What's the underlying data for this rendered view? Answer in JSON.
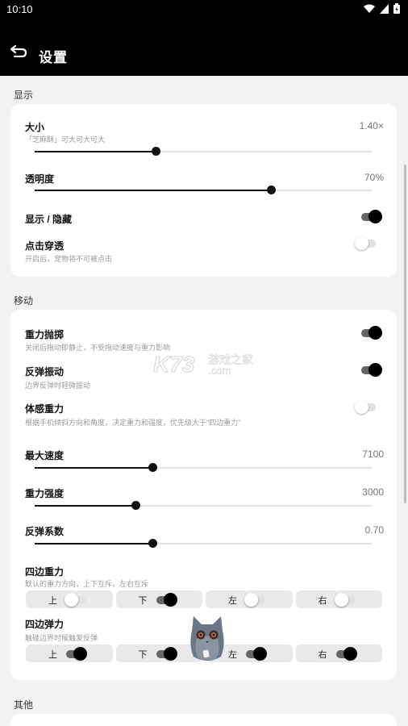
{
  "status_bar": {
    "time": "10:10"
  },
  "header": {
    "title": "设置"
  },
  "sections": {
    "display": {
      "title": "显示",
      "size": {
        "label": "大小",
        "desc": "「芝麻酥」可大可大可大",
        "value": "1.40×",
        "level": 0.36
      },
      "opacity": {
        "label": "透明度",
        "value": "70%",
        "level": 0.7
      },
      "visibility": {
        "label": "显示 / 隐藏",
        "on": true
      },
      "click_through": {
        "label": "点击穿透",
        "desc": "开启后，宠物将不可被点击",
        "on": false
      }
    },
    "movement": {
      "title": "移动",
      "gravity_throw": {
        "label": "重力抛掷",
        "desc": "关闭后拖动即静止，不受拖动速度与重力影响",
        "on": true
      },
      "bounce_vibrate": {
        "label": "反弹振动",
        "desc": "边界反弹时轻微振动",
        "on": true
      },
      "motion_gravity": {
        "label": "体感重力",
        "desc": "根据手机倾斜方向和角度，决定重力和强度。优先级大于\"四边重力\"",
        "on": false
      },
      "max_speed": {
        "label": "最大速度",
        "value": "7100",
        "level": 0.35
      },
      "gravity_strength": {
        "label": "重力强度",
        "value": "3000",
        "level": 0.3
      },
      "bounce_coef": {
        "label": "反弹系数",
        "value": "0.70",
        "level": 0.35
      },
      "edge_gravity": {
        "label": "四边重力",
        "desc": "默认的重力方向，上下互斥，左右互斥",
        "buttons": [
          {
            "label": "上",
            "on": false
          },
          {
            "label": "下",
            "on": true
          },
          {
            "label": "左",
            "on": false
          },
          {
            "label": "右",
            "on": false
          }
        ]
      },
      "edge_bounce": {
        "label": "四边弹力",
        "desc": "触碰边界时候触发反弹",
        "buttons": [
          {
            "label": "上",
            "on": true
          },
          {
            "label": "下",
            "on": true
          },
          {
            "label": "左",
            "on": true
          },
          {
            "label": "右",
            "on": true
          }
        ]
      }
    },
    "other": {
      "title": "其他"
    }
  },
  "watermark": {
    "brand": "K73",
    "site": "游戏之家",
    "domain": ".com"
  },
  "colors": {
    "bar_bg": "#000000",
    "page_bg": "#f2f2f2",
    "card_bg": "#ffffff",
    "accent": "#111111"
  }
}
